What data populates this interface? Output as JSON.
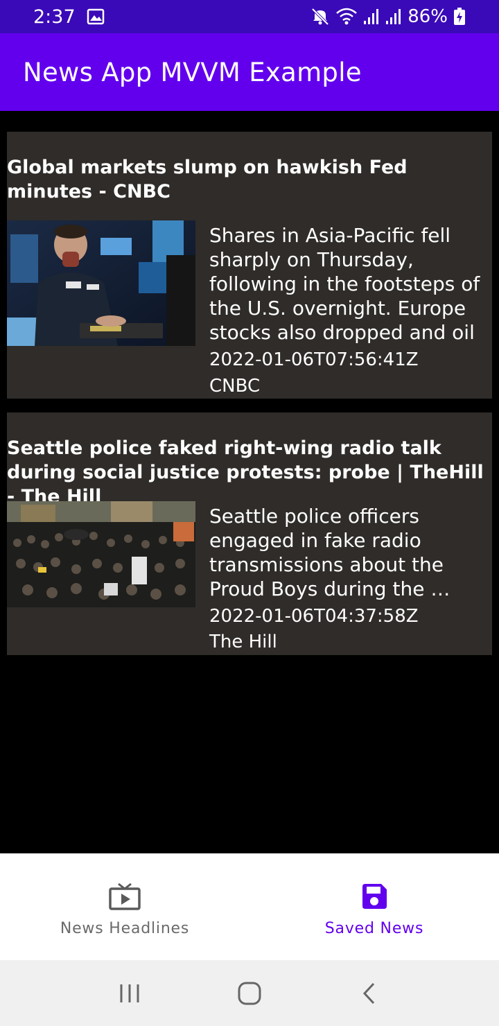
{
  "status_bar": {
    "time": "2:37",
    "battery": "86%",
    "icons": [
      "image-icon",
      "mute-icon",
      "wifi-icon",
      "signal-icon",
      "signal-icon",
      "battery-charging-icon"
    ]
  },
  "app_bar": {
    "title": "News App MVVM Example",
    "color": "#6200ee"
  },
  "articles": [
    {
      "title": "Global markets slump on hawkish Fed minutes - CNBC",
      "description": "Shares in Asia-Pacific fell sharply on Thursday, following in the footsteps of the U.S. overnight. Europe stocks also dropped and oil",
      "published_at": "2022-01-06T07:56:41Z",
      "source": "CNBC"
    },
    {
      "title": "Seattle police faked right-wing radio talk during social justice protests: probe | TheHill - The Hill",
      "description": "Seattle police officers engaged in fake radio transmissions about the Proud Boys during the …",
      "published_at": "2022-01-06T04:37:58Z",
      "source": "The Hill"
    }
  ],
  "bottom_nav": {
    "items": [
      {
        "label": "News Headlines",
        "icon": "tv-icon",
        "active": false
      },
      {
        "label": "Saved News",
        "icon": "save-icon",
        "active": true
      }
    ],
    "active_color": "#6200ee",
    "inactive_color": "#6a6a6a"
  },
  "system_nav": {
    "buttons": [
      "recent-apps-icon",
      "home-icon",
      "back-icon"
    ]
  }
}
